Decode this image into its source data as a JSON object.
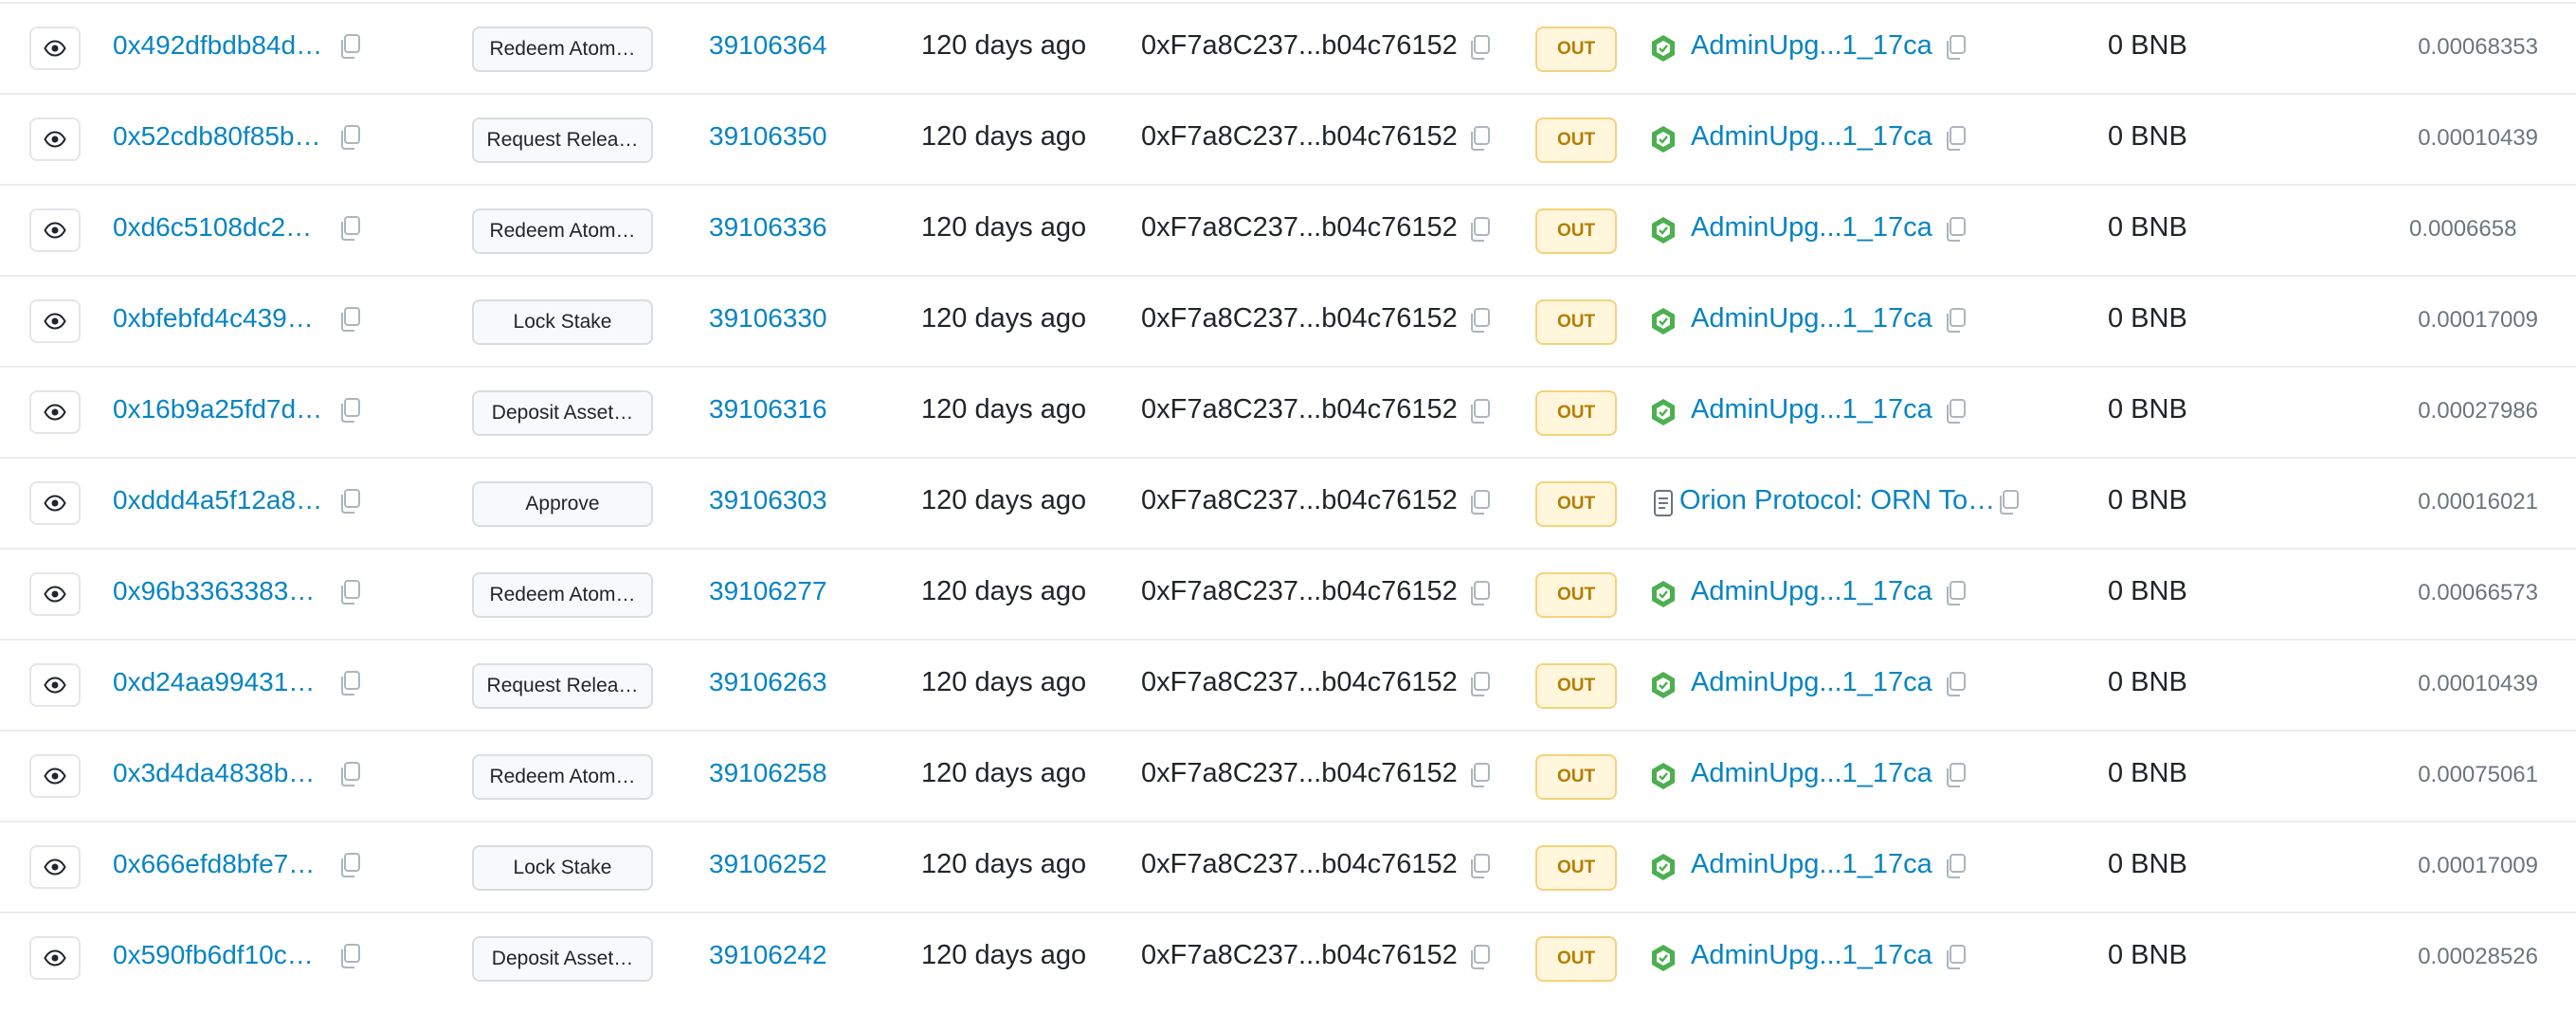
{
  "table": {
    "direction_label": "OUT",
    "rows": [
      {
        "tx_hash": "0x492dfbdb84d…",
        "method": "Redeem Atom…",
        "block": "39106364",
        "age": "120 days ago",
        "from": "0xF7a8C237...b04c76152",
        "to_icon": "contract-verified-icon",
        "to": "AdminUpg...1_17ca",
        "value": "0 BNB",
        "fee": "0.00068353"
      },
      {
        "tx_hash": "0x52cdb80f85b…",
        "method": "Request Relea…",
        "block": "39106350",
        "age": "120 days ago",
        "from": "0xF7a8C237...b04c76152",
        "to_icon": "contract-verified-icon",
        "to": "AdminUpg...1_17ca",
        "value": "0 BNB",
        "fee": "0.00010439"
      },
      {
        "tx_hash": "0xd6c5108dc2…",
        "method": "Redeem Atom…",
        "block": "39106336",
        "age": "120 days ago",
        "from": "0xF7a8C237...b04c76152",
        "to_icon": "contract-verified-icon",
        "to": "AdminUpg...1_17ca",
        "value": "0 BNB",
        "fee": "0.0006658"
      },
      {
        "tx_hash": "0xbfebfd4c439…",
        "method": "Lock Stake",
        "block": "39106330",
        "age": "120 days ago",
        "from": "0xF7a8C237...b04c76152",
        "to_icon": "contract-verified-icon",
        "to": "AdminUpg...1_17ca",
        "value": "0 BNB",
        "fee": "0.00017009"
      },
      {
        "tx_hash": "0x16b9a25fd7d…",
        "method": "Deposit Asset…",
        "block": "39106316",
        "age": "120 days ago",
        "from": "0xF7a8C237...b04c76152",
        "to_icon": "contract-verified-icon",
        "to": "AdminUpg...1_17ca",
        "value": "0 BNB",
        "fee": "0.00027986"
      },
      {
        "tx_hash": "0xddd4a5f12a8…",
        "method": "Approve",
        "block": "39106303",
        "age": "120 days ago",
        "from": "0xF7a8C237...b04c76152",
        "to_icon": "contract-document-icon",
        "to": "Orion Protocol: ORN To…",
        "value": "0 BNB",
        "fee": "0.00016021"
      },
      {
        "tx_hash": "0x96b3363383…",
        "method": "Redeem Atom…",
        "block": "39106277",
        "age": "120 days ago",
        "from": "0xF7a8C237...b04c76152",
        "to_icon": "contract-verified-icon",
        "to": "AdminUpg...1_17ca",
        "value": "0 BNB",
        "fee": "0.00066573"
      },
      {
        "tx_hash": "0xd24aa99431…",
        "method": "Request Relea…",
        "block": "39106263",
        "age": "120 days ago",
        "from": "0xF7a8C237...b04c76152",
        "to_icon": "contract-verified-icon",
        "to": "AdminUpg...1_17ca",
        "value": "0 BNB",
        "fee": "0.00010439"
      },
      {
        "tx_hash": "0x3d4da4838b…",
        "method": "Redeem Atom…",
        "block": "39106258",
        "age": "120 days ago",
        "from": "0xF7a8C237...b04c76152",
        "to_icon": "contract-verified-icon",
        "to": "AdminUpg...1_17ca",
        "value": "0 BNB",
        "fee": "0.00075061"
      },
      {
        "tx_hash": "0x666efd8bfe7…",
        "method": "Lock Stake",
        "block": "39106252",
        "age": "120 days ago",
        "from": "0xF7a8C237...b04c76152",
        "to_icon": "contract-verified-icon",
        "to": "AdminUpg...1_17ca",
        "value": "0 BNB",
        "fee": "0.00017009"
      },
      {
        "tx_hash": "0x590fb6df10c…",
        "method": "Deposit Asset…",
        "block": "39106242",
        "age": "120 days ago",
        "from": "0xF7a8C237...b04c76152",
        "to_icon": "contract-verified-icon",
        "to": "AdminUpg...1_17ca",
        "value": "0 BNB",
        "fee": "0.00028526"
      }
    ]
  },
  "colors": {
    "link": "#0784c3",
    "out_badge_bg": "#fff6dc",
    "out_badge_text": "#b47d00",
    "verified_contract_icon": "#3cb371",
    "fee_text": "#6c757d"
  }
}
